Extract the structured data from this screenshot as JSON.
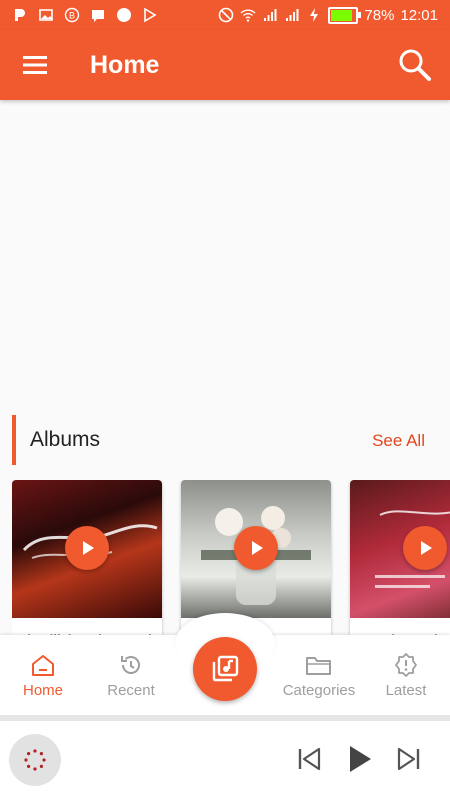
{
  "status_bar": {
    "battery": "78%",
    "time": "12:01",
    "battery_level": 0.78
  },
  "app_bar": {
    "title": "Home"
  },
  "albums": {
    "section_title": "Albums",
    "see_all": "See All",
    "items": [
      {
        "name": "Bismillah Mohammed"
      },
      {
        "name": ""
      },
      {
        "name": "Does he not know"
      }
    ]
  },
  "bottom_nav": {
    "items": [
      {
        "label": "Home",
        "icon": "home-icon",
        "active": true
      },
      {
        "label": "Recent",
        "icon": "history-icon",
        "active": false
      },
      {
        "label": "Categories",
        "icon": "folder-icon",
        "active": false
      },
      {
        "label": "Latest",
        "icon": "badge-icon",
        "active": false
      }
    ],
    "fab_icon": "music-library-icon"
  },
  "colors": {
    "accent": "#f05a2e",
    "inactive": "#9e9e9e"
  }
}
